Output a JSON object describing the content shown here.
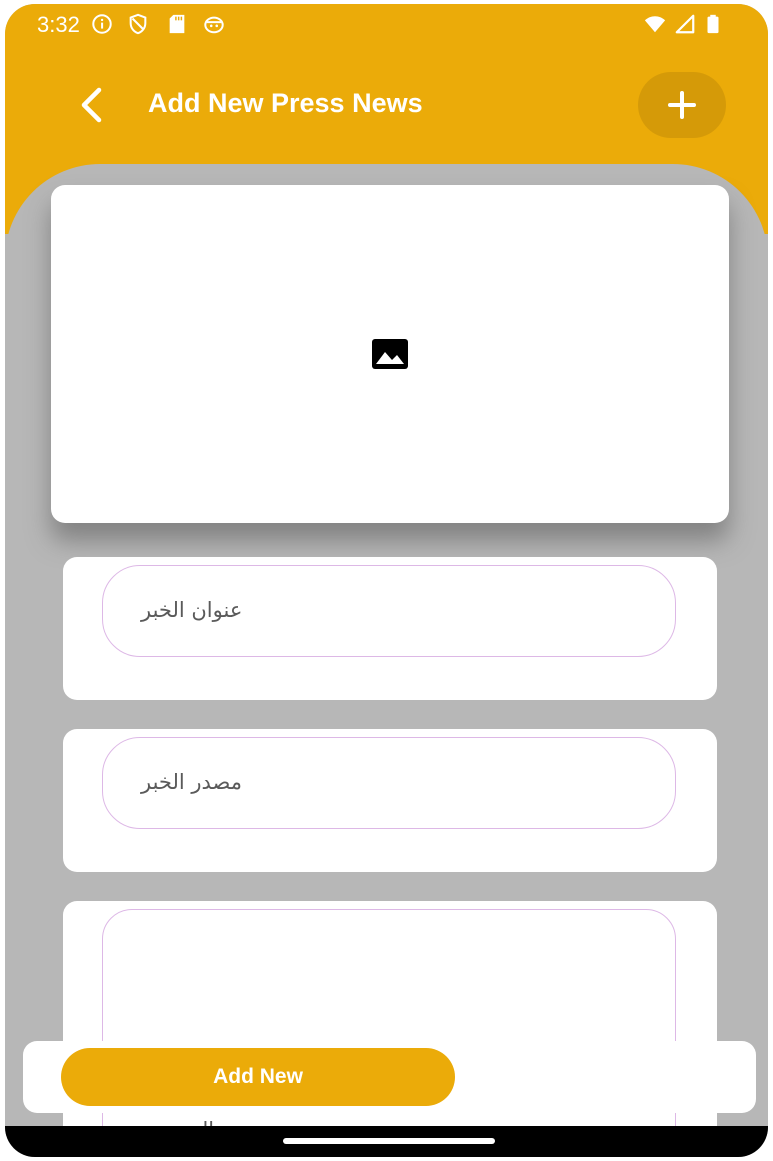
{
  "status_bar": {
    "time": "3:32",
    "left_icons": [
      "info-icon",
      "vpn-shield-icon",
      "sd-card-icon",
      "notification-app-icon"
    ],
    "right_icons": [
      "wifi-icon",
      "signal-icon",
      "battery-icon"
    ]
  },
  "header": {
    "back_icon": "chevron-left-icon",
    "title": "Add New Press News",
    "action_icon": "plus-icon"
  },
  "image_picker": {
    "icon": "image-placeholder-icon"
  },
  "form": {
    "title_field": {
      "placeholder": "عنوان الخبر",
      "value": ""
    },
    "source_field": {
      "placeholder": "مصدر الخبر",
      "value": ""
    },
    "body_field": {
      "placeholder": "ال...",
      "value": ""
    }
  },
  "footer": {
    "submit_label": "Add New"
  },
  "colors": {
    "primary": "#ebab09",
    "primary_dark": "#d59a08",
    "background": "#b7b7b7",
    "input_border": "#ddb8e6",
    "surface": "#ffffff"
  }
}
